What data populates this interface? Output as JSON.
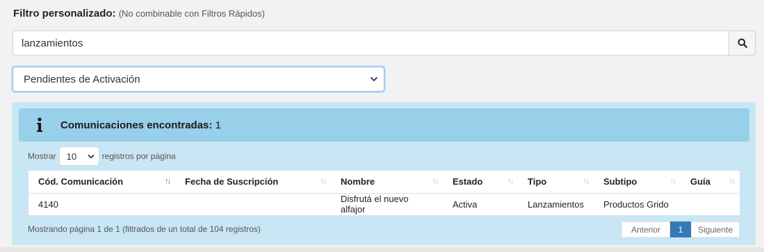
{
  "filter": {
    "label": "Filtro personalizado:",
    "note": "(No combinable con Filtros Rápidos)",
    "search_value": "lanzamientos",
    "status_selected": "Pendientes de Activación"
  },
  "results": {
    "label": "Comunicaciones encontradas:",
    "count": "1"
  },
  "length": {
    "prefix": "Mostrar",
    "value": "10",
    "suffix": "registros por página"
  },
  "table": {
    "columns": [
      "Cód. Comunicación",
      "Fecha de Suscripción",
      "Nombre",
      "Estado",
      "Tipo",
      "Subtipo",
      "Guía"
    ],
    "rows": [
      [
        "4140",
        "",
        "Disfrutá el nuevo alfajor",
        "Activa",
        "Lanzamientos",
        "Productos Grido",
        ""
      ]
    ]
  },
  "footer": {
    "info": "Mostrando página 1 de 1 (filtrados de un total de 104 registros)",
    "prev": "Anterior",
    "current_page": "1",
    "next": "Siguiente"
  }
}
